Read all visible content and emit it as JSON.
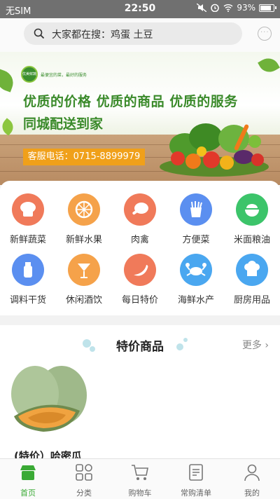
{
  "status_bar": {
    "carrier": "无SIM",
    "time": "22:50",
    "battery": "93%"
  },
  "search": {
    "placeholder": "大家都在搜：鸡蛋 土豆"
  },
  "banner": {
    "logo_text": "优美鲜蔬",
    "logo_tag": "最便宜的菜，最好的服务",
    "slogan_line1": "优质的价格  优质的商品  优质的服务",
    "slogan_line2": "同城配送到家",
    "phone": "客服电话：0715-8899979"
  },
  "categories": [
    {
      "label": "新鲜蔬菜",
      "color": "#f07a5a",
      "icon": "vegetable-icon"
    },
    {
      "label": "新鲜水果",
      "color": "#f5a24a",
      "icon": "fruit-icon"
    },
    {
      "label": "肉禽",
      "color": "#f07a5a",
      "icon": "meat-icon"
    },
    {
      "label": "方便菜",
      "color": "#5b8ff0",
      "icon": "fast-food-icon"
    },
    {
      "label": "米面粮油",
      "color": "#3cc46a",
      "icon": "rice-icon"
    },
    {
      "label": "调料干货",
      "color": "#5b8ff0",
      "icon": "seasoning-icon"
    },
    {
      "label": "休闲酒饮",
      "color": "#f5a24a",
      "icon": "drink-icon"
    },
    {
      "label": "每日特价",
      "color": "#f07a5a",
      "icon": "chili-icon"
    },
    {
      "label": "海鲜水产",
      "color": "#4aa7f0",
      "icon": "crab-icon"
    },
    {
      "label": "厨房用品",
      "color": "#4aa7f0",
      "icon": "chef-hat-icon"
    }
  ],
  "special": {
    "title": "特价商品",
    "more": "更多",
    "product_name": "(特价）哈密瓜"
  },
  "tabs": [
    {
      "label": "首页",
      "icon": "home-icon"
    },
    {
      "label": "分类",
      "icon": "grid-icon"
    },
    {
      "label": "购物车",
      "icon": "cart-icon"
    },
    {
      "label": "常购清单",
      "icon": "list-icon"
    },
    {
      "label": "我的",
      "icon": "user-icon"
    }
  ],
  "colors": {
    "accent": "#3aaa35",
    "banner_green": "#3a8a2a",
    "phone_bar": "#f0a01a"
  }
}
